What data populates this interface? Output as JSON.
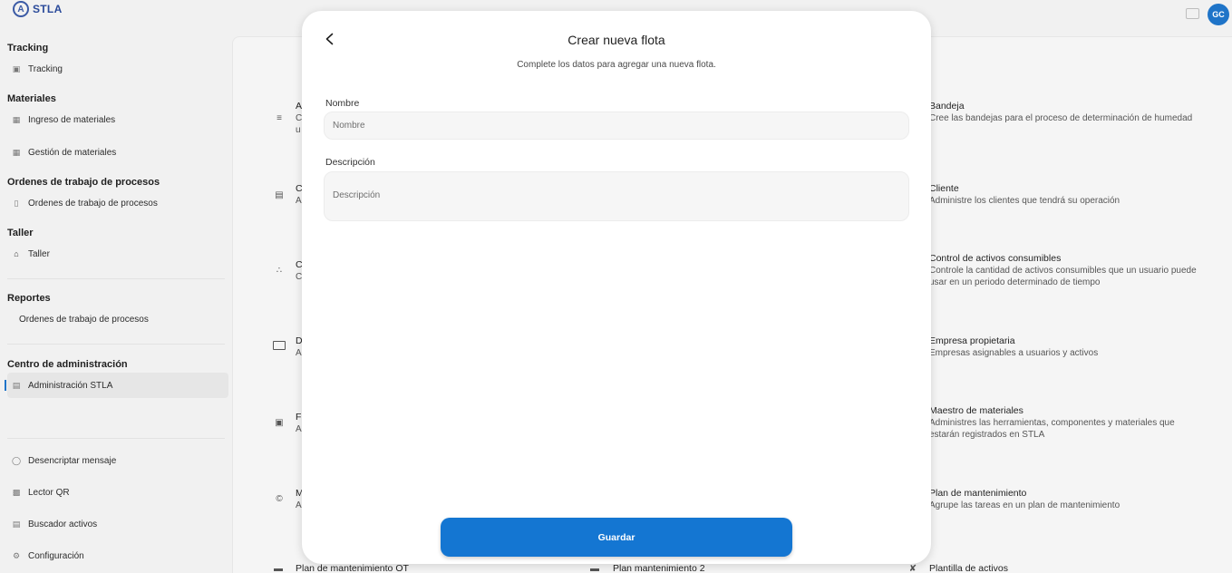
{
  "app": {
    "logo_mark": "A",
    "logo_text": "STLA",
    "avatar_initials": "GC"
  },
  "sidebar": {
    "sections": [
      {
        "title": "Tracking",
        "items": [
          {
            "label": "Tracking",
            "icon": "truck-icon"
          }
        ]
      },
      {
        "title": "Materiales",
        "items": [
          {
            "label": "Ingreso de materiales",
            "icon": "clipboard-icon"
          },
          {
            "label": "Gestión de materiales",
            "icon": "clipboard-icon"
          }
        ]
      },
      {
        "title": "Ordenes de trabajo de procesos",
        "items": [
          {
            "label": "Ordenes de trabajo de procesos",
            "icon": "phone-icon"
          }
        ]
      },
      {
        "title": "Taller",
        "items": [
          {
            "label": "Taller",
            "icon": "home-icon"
          }
        ]
      },
      {
        "title": "Reportes",
        "items": [
          {
            "label": "Ordenes de trabajo de procesos",
            "icon": ""
          }
        ]
      },
      {
        "title": "Centro de administración",
        "items": [
          {
            "label": "Administración STLA",
            "icon": "admin-icon"
          }
        ]
      }
    ],
    "bottom": [
      {
        "label": "Desencriptar mensaje",
        "icon": "shield-icon"
      },
      {
        "label": "Lector QR",
        "icon": "qr-icon"
      },
      {
        "label": "Buscador activos",
        "icon": "search-list-icon"
      },
      {
        "label": "Configuración",
        "icon": "gear-icon"
      }
    ]
  },
  "background": {
    "left_col_letters": [
      "A",
      "C",
      "C",
      "D",
      "F",
      "M"
    ],
    "left_col_sub_letters": [
      "C",
      "A",
      "C",
      "A",
      "A",
      "A"
    ],
    "left_col_extra": "u",
    "right_cards": [
      {
        "title": "Bandeja",
        "desc": "Cree las bandejas para el proceso de determinación de humedad"
      },
      {
        "title": "Cliente",
        "desc": "Administre los clientes que tendrá su operación"
      },
      {
        "title": "Control de activos consumibles",
        "desc": "Controle la cantidad de activos consumibles que un usuario puede usar en un periodo determinado de tiempo"
      },
      {
        "title": "Empresa propietaria",
        "desc": "Empresas asignables a usuarios y activos"
      },
      {
        "title": "Maestro de materiales",
        "desc": "Administres las herramientas, componentes y materiales que estarán registrados en STLA"
      },
      {
        "title": "Plan de mantenimiento",
        "desc": "Agrupe las tareas en un plan de mantenimiento"
      }
    ],
    "bottom_peek": [
      "Plan de mantenimiento OT",
      "Plan mantenimiento 2",
      "Plantilla de activos"
    ]
  },
  "modal": {
    "title": "Crear nueva flota",
    "subtitle": "Complete los datos para agregar una nueva flota.",
    "name_label": "Nombre",
    "name_placeholder": "Nombre",
    "desc_label": "Descripción",
    "desc_placeholder": "Descripción",
    "save_label": "Guardar"
  },
  "colors": {
    "accent": "#1476d2",
    "avatar": "#1f74c8"
  }
}
